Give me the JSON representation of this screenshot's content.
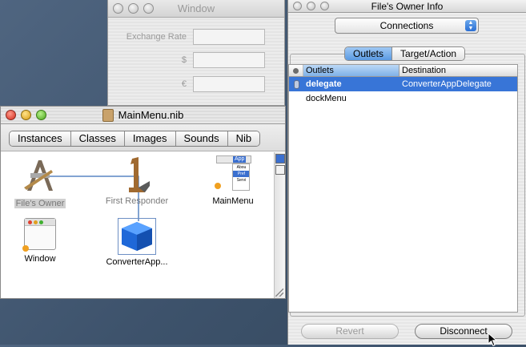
{
  "background_window": {
    "title": "Window",
    "fields": [
      {
        "label": "Exchange Rate",
        "value": ""
      },
      {
        "label": "$",
        "value": ""
      },
      {
        "label": "€",
        "value": ""
      }
    ]
  },
  "info_panel": {
    "title": "File's Owner Info",
    "popup_value": "Connections",
    "segments": [
      {
        "label": "Outlets",
        "active": true
      },
      {
        "label": "Target/Action",
        "active": false
      }
    ],
    "table": {
      "columns": [
        "Outlets",
        "Destination"
      ],
      "rows": [
        {
          "outlet": "delegate",
          "destination": "ConverterAppDelegate",
          "selected": true
        },
        {
          "outlet": "dockMenu",
          "destination": "",
          "selected": false
        }
      ]
    },
    "buttons": {
      "revert": "Revert",
      "disconnect": "Disconnect"
    }
  },
  "nib_window": {
    "title": "MainMenu.nib",
    "tabs": [
      "Instances",
      "Classes",
      "Images",
      "Sounds",
      "Nib"
    ],
    "items": [
      {
        "label": "File's Owner",
        "icon": "files-owner-icon"
      },
      {
        "label": "First Responder",
        "icon": "first-responder-icon"
      },
      {
        "label": "MainMenu",
        "icon": "menu-icon"
      },
      {
        "label": "Window",
        "icon": "window-icon"
      },
      {
        "label": "ConverterApp...",
        "icon": "cube-icon"
      }
    ],
    "menu_preview_items": [
      "App",
      "Abou",
      "Pref",
      "Servi"
    ]
  },
  "colors": {
    "selection_blue": "#3875d7",
    "desktop": "#425874",
    "connection_line": "#5a86c4"
  }
}
